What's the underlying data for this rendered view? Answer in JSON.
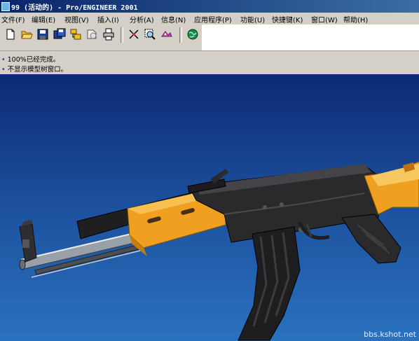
{
  "window": {
    "title": "99 (活动的) - Pro/ENGINEER 2001"
  },
  "menu": [
    "文件(F)",
    "编辑(E)",
    "视图(V)",
    "插入(I)",
    "分析(A)",
    "信息(N)",
    "应用程序(P)",
    "功能(U)",
    "快捷键(K)",
    "窗口(W)",
    "帮助(H)"
  ],
  "toolbar": {
    "icons": [
      "new-file-icon",
      "open-folder-icon",
      "save-icon",
      "save-copy-icon",
      "model-tree-icon",
      "erase-icon",
      "print-icon",
      "spin-center-icon",
      "zoom-icon",
      "orient-icon",
      "web-browser-icon"
    ]
  },
  "messages": [
    "100%已经完成。",
    "不显示模型树窗口。"
  ],
  "watermark": "bbs.kshot.net",
  "colors": {
    "viewport_top": "#0d2a74",
    "viewport_bottom": "#2a72bf",
    "stock": "#f0a020",
    "metal": "#2b2b2b"
  }
}
